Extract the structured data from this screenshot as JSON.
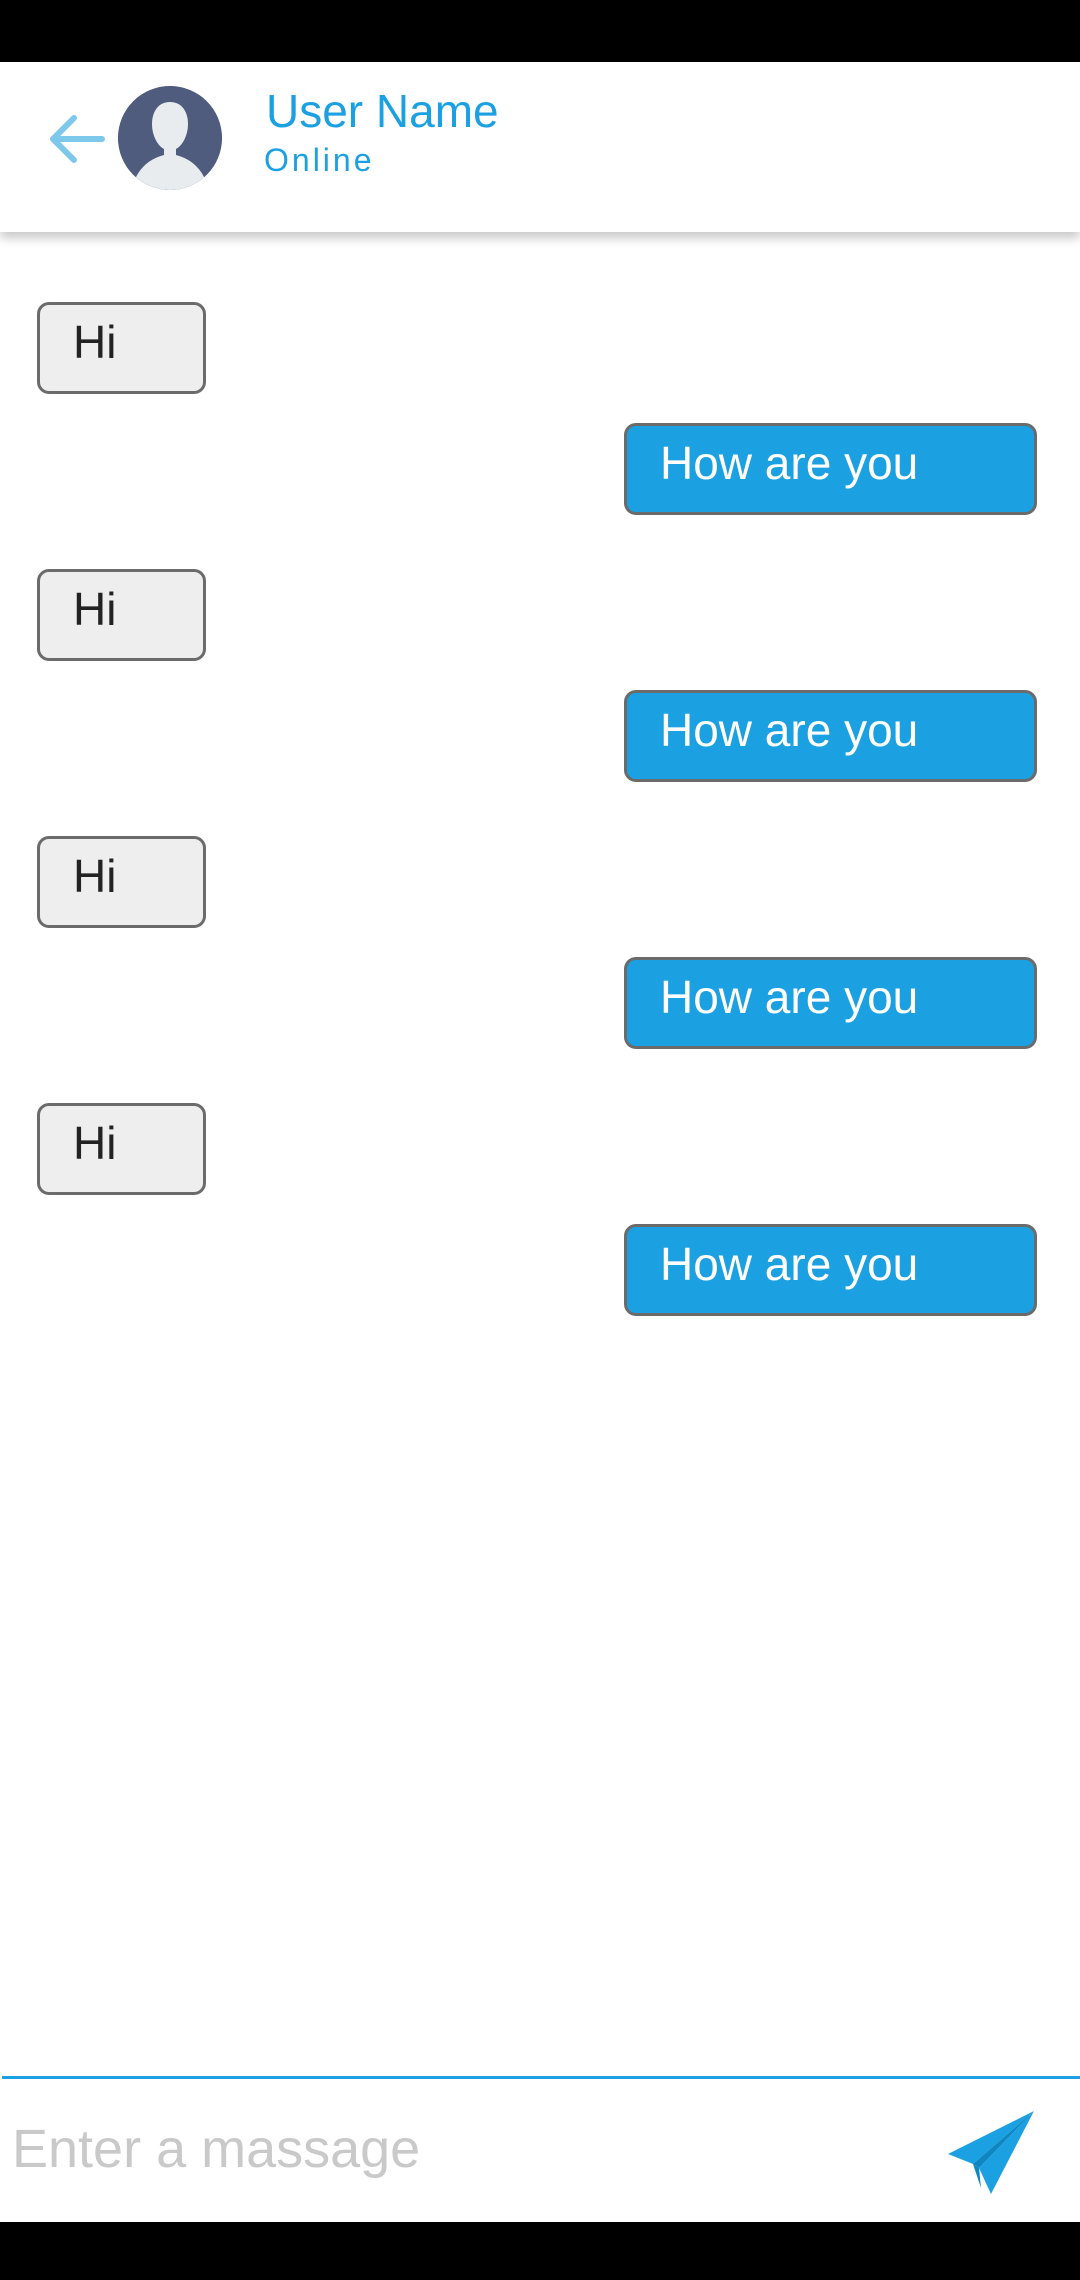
{
  "header": {
    "back_icon": "arrow-left-icon",
    "avatar_icon": "user-silhouette-icon",
    "user_name": "User Name",
    "status": "Online"
  },
  "messages": [
    {
      "direction": "incoming",
      "text": "Hi"
    },
    {
      "direction": "outgoing",
      "text": "How are you"
    },
    {
      "direction": "incoming",
      "text": "Hi"
    },
    {
      "direction": "outgoing",
      "text": "How are you"
    },
    {
      "direction": "incoming",
      "text": "Hi"
    },
    {
      "direction": "outgoing",
      "text": "How are you"
    },
    {
      "direction": "incoming",
      "text": "Hi"
    },
    {
      "direction": "outgoing",
      "text": "How are you"
    }
  ],
  "composer": {
    "placeholder": "Enter a massage",
    "value": "",
    "send_icon": "paper-plane-send-icon"
  },
  "colors": {
    "accent": "#1ba1e2",
    "incoming_bubble": "#eeeeee",
    "bubble_border": "#6b6b6b",
    "avatar_bg": "#4f5c7e",
    "back_arrow": "#7ec8ec",
    "placeholder": "#c9c9c9"
  }
}
